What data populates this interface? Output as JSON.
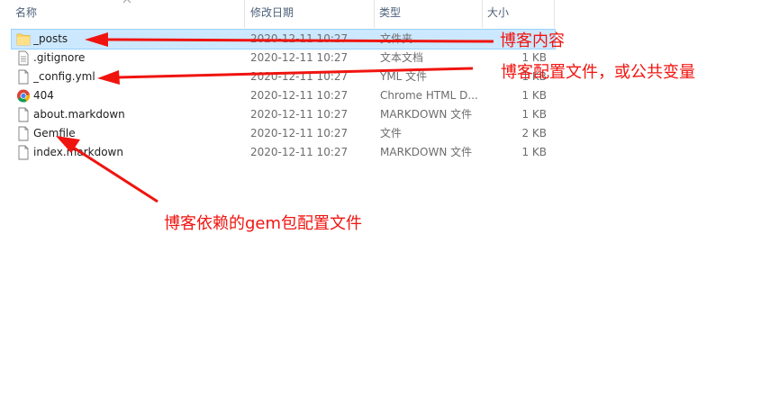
{
  "header": {
    "name": "名称",
    "date": "修改日期",
    "type": "类型",
    "size": "大小"
  },
  "files": [
    {
      "name": "_posts",
      "date": "2020-12-11 10:27",
      "type": "文件夹",
      "size": "",
      "icon": "folder-icon",
      "selected": true
    },
    {
      "name": ".gitignore",
      "date": "2020-12-11 10:27",
      "type": "文本文档",
      "size": "1 KB",
      "icon": "text-file-icon"
    },
    {
      "name": "_config.yml",
      "date": "2020-12-11 10:27",
      "type": "YML 文件",
      "size": "1 KB",
      "icon": "file-icon"
    },
    {
      "name": "404",
      "date": "2020-12-11 10:27",
      "type": "Chrome HTML D...",
      "size": "1 KB",
      "icon": "chrome-icon"
    },
    {
      "name": "about.markdown",
      "date": "2020-12-11 10:27",
      "type": "MARKDOWN 文件",
      "size": "1 KB",
      "icon": "file-icon"
    },
    {
      "name": "Gemfile",
      "date": "2020-12-11 10:27",
      "type": "文件",
      "size": "2 KB",
      "icon": "file-icon"
    },
    {
      "name": "index.markdown",
      "date": "2020-12-11 10:27",
      "type": "MARKDOWN 文件",
      "size": "1 KB",
      "icon": "file-icon"
    }
  ],
  "annotations": {
    "posts": "博客内容",
    "config": "博客配置文件，或公共变量",
    "gemfile": "博客依赖的gem包配置文件"
  },
  "colors": {
    "annotation": "#f0140f",
    "selection": "#cce8ff",
    "header_text": "#4c607a"
  }
}
